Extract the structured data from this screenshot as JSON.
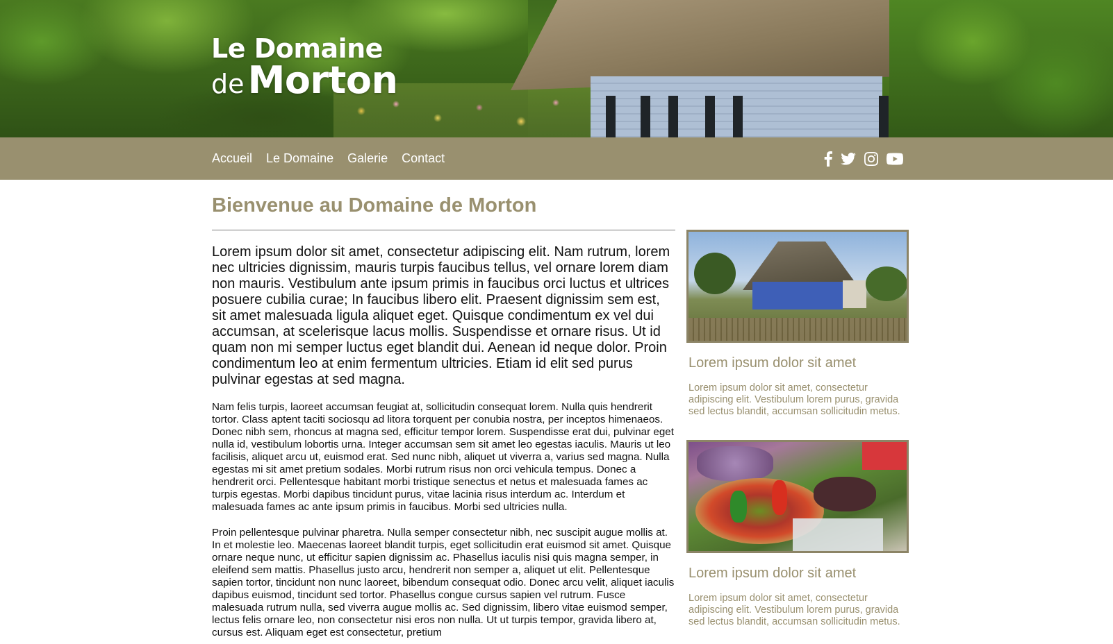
{
  "site": {
    "logo_line1": "Le Domaine",
    "logo_line2_small": "de",
    "logo_line2_big": "Morton"
  },
  "nav": {
    "items": [
      {
        "label": "Accueil"
      },
      {
        "label": "Le Domaine"
      },
      {
        "label": "Galerie"
      },
      {
        "label": "Contact"
      }
    ],
    "social": [
      "facebook-icon",
      "twitter-icon",
      "instagram-icon",
      "youtube-icon"
    ]
  },
  "colors": {
    "accent": "#99906f",
    "text": "#111111",
    "background": "#ffffff"
  },
  "main": {
    "title": "Bienvenue au Domaine de Morton",
    "lead": "Lorem ipsum dolor sit amet, consectetur adipiscing elit. Nam rutrum, lorem nec ultricies dignissim, mauris turpis faucibus tellus, vel ornare lorem diam non mauris. Vestibulum ante ipsum primis in faucibus orci luctus et ultrices posuere cubilia curae; In faucibus libero elit. Praesent dignissim sem est, sit amet malesuada ligula aliquet eget. Quisque condimentum ex vel dui accumsan, at scelerisque lacus mollis. Suspendisse et ornare risus. Ut id quam non mi semper luctus eget blandit dui. Aenean id neque dolor. Proin condimentum leo at enim fermentum ultricies. Etiam id elit sed purus pulvinar egestas at sed magna.",
    "paragraph1": "Nam felis turpis, laoreet accumsan feugiat at, sollicitudin consequat lorem. Nulla quis hendrerit tortor. Class aptent taciti sociosqu ad litora torquent per conubia nostra, per inceptos himenaeos. Donec nibh sem, rhoncus at magna sed, efficitur tempor lorem. Suspendisse erat dui, pulvinar eget nulla id, vestibulum lobortis urna. Integer accumsan sem sit amet leo egestas iaculis. Mauris ut leo facilisis, aliquet arcu ut, euismod erat. Sed nunc nibh, aliquet ut viverra a, varius sed magna. Nulla egestas mi sit amet pretium sodales. Morbi rutrum risus non orci vehicula tempus. Donec a hendrerit orci. Pellentesque habitant morbi tristique senectus et netus et malesuada fames ac turpis egestas. Morbi dapibus tincidunt purus, vitae lacinia risus interdum ac. Interdum et malesuada fames ac ante ipsum primis in faucibus. Morbi sed ultricies nulla.",
    "paragraph2": "Proin pellentesque pulvinar pharetra. Nulla semper consectetur nibh, nec suscipit augue mollis at. In et molestie leo. Maecenas laoreet blandit turpis, eget sollicitudin erat euismod sit amet. Quisque ornare neque nunc, ut efficitur sapien dignissim ac. Phasellus iaculis nisi quis magna semper, in eleifend sem mattis. Phasellus justo arcu, hendrerit non semper a, aliquet ut elit. Pellentesque sapien tortor, tincidunt non nunc laoreet, bibendum consequat odio. Donec arcu velit, aliquet iaculis dapibus euismod, tincidunt sed tortor. Phasellus congue cursus sapien vel rutrum. Fusce malesuada rutrum nulla, sed viverra augue mollis ac. Sed dignissim, libero vitae euismod semper, lectus felis ornare leo, non consectetur nisi eros non nulla. Ut ut turpis tempor, gravida libero at, cursus est. Aliquam eget est consectetur, pretium"
  },
  "sidebar": {
    "cards": [
      {
        "title": "Lorem ipsum dolor sit amet",
        "text": "Lorem ipsum dolor sit amet, consectetur adipiscing elit. Vestibulum lorem purus, gravida sed lectus blandit, accumsan sollicitudin metus."
      },
      {
        "title": "Lorem ipsum dolor sit amet",
        "text": "Lorem ipsum dolor sit amet, consectetur adipiscing elit. Vestibulum lorem purus, gravida sed lectus blandit, accumsan sollicitudin metus."
      }
    ]
  }
}
